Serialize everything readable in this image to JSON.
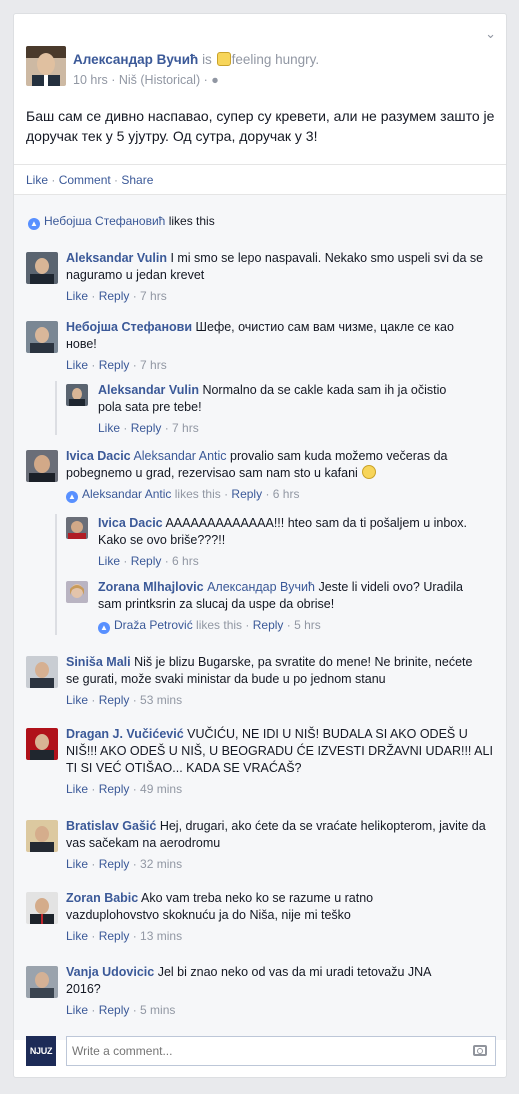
{
  "post": {
    "author": "Александар Вучић",
    "is_word": "is",
    "feeling": "feeling hungry.",
    "time": "10 hrs",
    "location": "Niš (Historical)",
    "text": "Баш сам се дивно наспавао, супер су кревети, али не разумем зашто је доручак тек у 5 ујутру. Од сутра, доручак у 3!"
  },
  "actions": {
    "like": "Like",
    "comment": "Comment",
    "share": "Share"
  },
  "likes": {
    "name": "Небојша Стефановић",
    "suffix": " likes this"
  },
  "comments": [
    {
      "name": "Aleksandar Vulin",
      "text": "I mi smo se lepo naspavali. Nekako smo uspeli svi da se naguramo u jedan krevet",
      "like": "Like",
      "reply": "Reply",
      "time": "7 hrs"
    },
    {
      "name": "Небојша Стефанови",
      "text": "Шефе, очистио сам вам чизме, цаклe се као нове!",
      "like": "Like",
      "reply": "Reply",
      "time": "7 hrs"
    },
    {
      "name": "Aleksandar Vulin",
      "text": "Normalno da se cakle kada sam ih ja očistio pola sata pre tebe!",
      "like": "Like",
      "reply": "Reply",
      "time": "7 hrs"
    },
    {
      "name": "Ivica Dacic",
      "tag": "Aleksandar Antic",
      "text": "provalio sam kuda možemo večeras da pobegnemo u grad, rezervisao sam nam sto u kafani",
      "liker": "Aleksandar Antic",
      "likes_this": "likes this",
      "reply": "Reply",
      "time": "6 hrs"
    },
    {
      "name": "Ivica Dacic",
      "text": "AAAAAAAAAAAAA!!! hteo sam da ti pošaljem u inbox. Kako se ovo briše???!!",
      "like": "Like",
      "reply": "Reply",
      "time": "6 hrs"
    },
    {
      "name": "Zorana Mlhajlovic",
      "tag": "Александар Вучић",
      "text": "Jeste li videli ovo? Uradila sam printksrin za slucaj da uspe da obrise!",
      "liker": "Draža Petrović",
      "likes_this": "likes this",
      "reply": "Reply",
      "time": "5 hrs"
    },
    {
      "name": "Siniša Mali",
      "text": "Niš je blizu Bugarske, pa svratite do mene! Ne brinite, nećete se gurati, može svaki ministar da bude u po jednom stanu",
      "like": "Like",
      "reply": "Reply",
      "time": "53 mins"
    },
    {
      "name": "Dragan J. Vučićević",
      "text": "VUČIĆU, NE IDI U NIŠ! BUDALA SI AKO ODEŠ U NIŠ!!! AKO ODEŠ U NIŠ, U BEOGRADU ĆE IZVESTI DRŽAVNI UDAR!!! ALI TI SI VEĆ OTIŠAO... KADA SE VRAĆAŠ?",
      "like": "Like",
      "reply": "Reply",
      "time": "49 mins"
    },
    {
      "name": "Bratislav Gašić",
      "text": "Hej, drugari, ako ćete da se vraćate helikopterom, javite da vas sačekam na aerodromu",
      "like": "Like",
      "reply": "Reply",
      "time": "32 mins"
    },
    {
      "name": "Zoran Babic",
      "text": "Ako vam treba neko ko se razume u ratno vazduplohovstvo skoknuću ja do Niša, nije mi teško",
      "like": "Like",
      "reply": "Reply",
      "time": "13 mins"
    },
    {
      "name": "Vanja Udovicic",
      "text": "Jel bi znao neko od vas da mi uradi tetovažu JNA 2016?",
      "like": "Like",
      "reply": "Reply",
      "time": "5 mins"
    }
  ],
  "composer": {
    "placeholder": "Write a comment...",
    "logo": "NJUZ"
  },
  "colors": {
    "link": "#3b5998",
    "muted": "#9197a3",
    "bg": "#e9eaed",
    "comments_bg": "#f6f7f9"
  }
}
